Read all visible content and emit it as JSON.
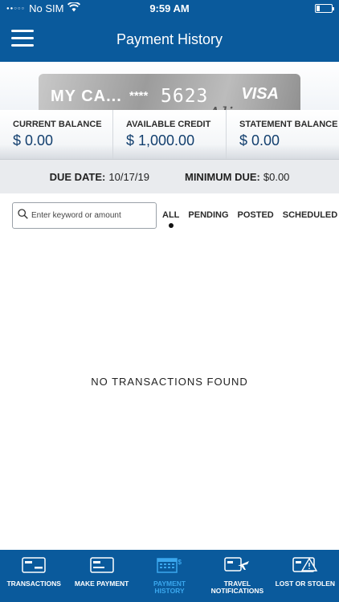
{
  "status_bar": {
    "carrier": "No SIM",
    "time": "9:59 AM",
    "battery_level": 0.2
  },
  "header": {
    "title": "Payment History",
    "menu_icon": "hamburger-icon"
  },
  "card": {
    "name": "MY CA...",
    "masked": "****",
    "last_digits": "5623",
    "brand": "VISA",
    "script_text": "Alion"
  },
  "balances": [
    {
      "label": "CURRENT BALANCE",
      "value": "$ 0.00"
    },
    {
      "label": "AVAILABLE CREDIT",
      "value": "$ 1,000.00"
    },
    {
      "label": "STATEMENT BALANCE",
      "value": "$ 0.00"
    }
  ],
  "due": {
    "date_label": "DUE DATE:",
    "date_value": "10/17/19",
    "min_label": "MINIMUM DUE:",
    "min_value": "$0.00"
  },
  "search": {
    "placeholder": "Enter keyword or amount",
    "icon": "search-icon"
  },
  "filters": {
    "all": "ALL",
    "pending": "PENDING",
    "posted": "POSTED",
    "scheduled": "SCHEDULED",
    "selected": "ALL"
  },
  "empty_message": "NO TRANSACTIONS FOUND",
  "tabs": [
    {
      "label": "TRANSACTIONS",
      "icon": "card-icon"
    },
    {
      "label": "MAKE PAYMENT",
      "icon": "card-icon"
    },
    {
      "label_line1": "PAYMENT",
      "label_line2": "HISTORY",
      "icon": "calendar-icon",
      "active": true
    },
    {
      "label_line1": "TRAVEL",
      "label_line2": "NOTIFICATIONS",
      "icon": "card-plane-icon"
    },
    {
      "label": "LOST OR STOLEN",
      "icon": "card-warning-icon"
    }
  ],
  "colors": {
    "brand_blue": "#0a5a9c",
    "active_tab": "#3aa7ee",
    "value_text": "#123f6e"
  }
}
